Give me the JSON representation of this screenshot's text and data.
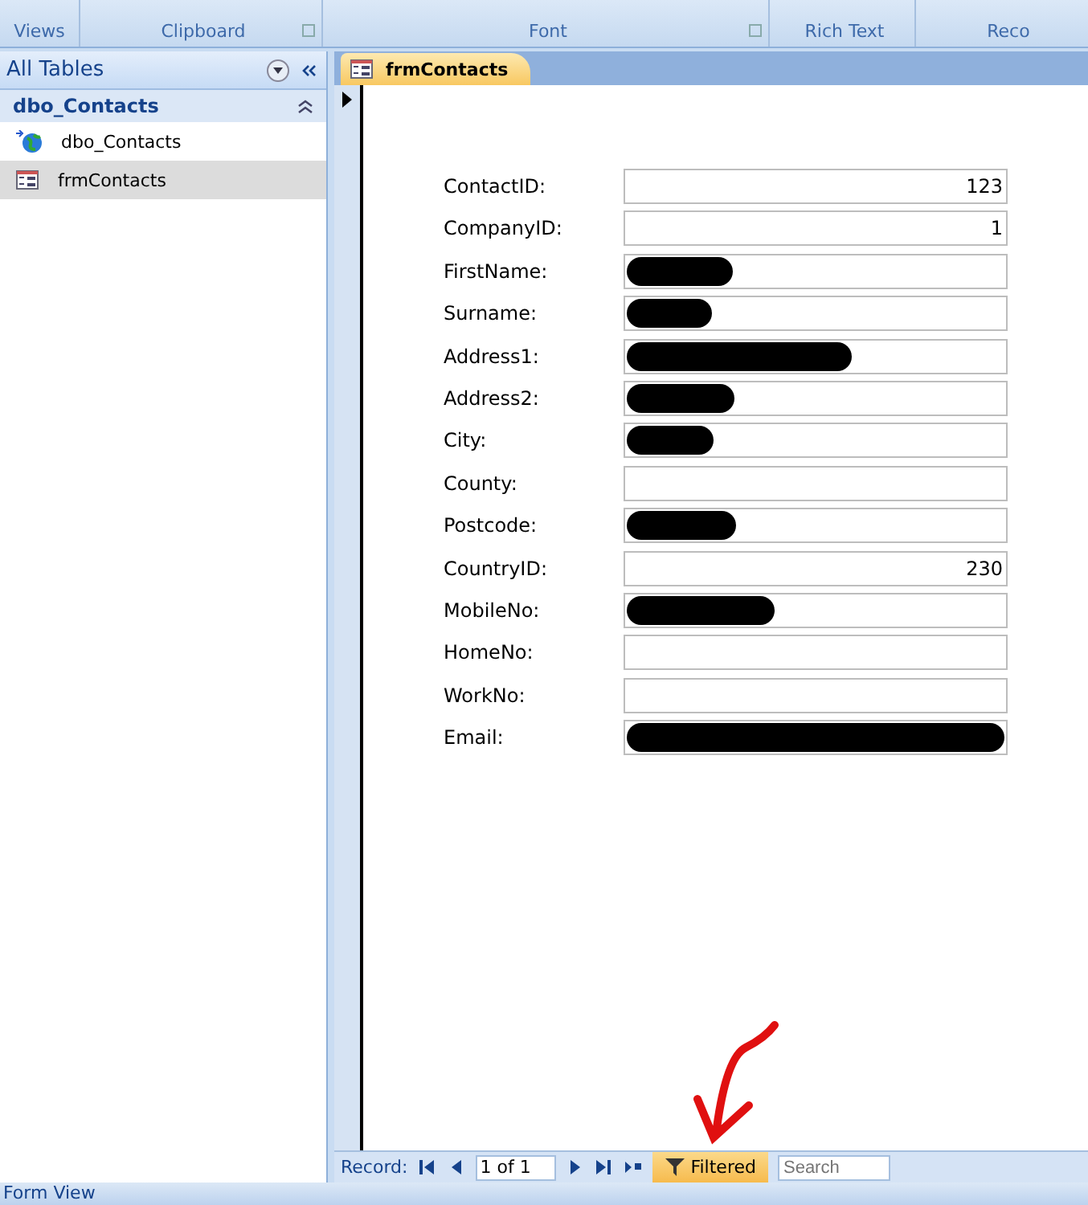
{
  "ribbon": {
    "groups": [
      {
        "label": "Views",
        "launcher": false
      },
      {
        "label": "Clipboard",
        "launcher": true
      },
      {
        "label": "Font",
        "launcher": true
      },
      {
        "label": "Rich Text",
        "launcher": false
      },
      {
        "label": "Reco",
        "launcher": false
      }
    ]
  },
  "nav_pane": {
    "title": "All Tables",
    "group": "dbo_Contacts",
    "items": [
      {
        "kind": "table",
        "label": "dbo_Contacts",
        "selected": false
      },
      {
        "kind": "form",
        "label": "frmContacts",
        "selected": true
      }
    ]
  },
  "document_tab": {
    "label": "frmContacts"
  },
  "form": {
    "fields": [
      {
        "label": "ContactID:",
        "value": "123",
        "redacted": false
      },
      {
        "label": "CompanyID:",
        "value": "1",
        "redacted": false
      },
      {
        "label": "FirstName:",
        "redacted": true
      },
      {
        "label": "Surname:",
        "redacted": true
      },
      {
        "label": "Address1:",
        "redacted": true
      },
      {
        "label": "Address2:",
        "redacted": true
      },
      {
        "label": "City:",
        "redacted": true
      },
      {
        "label": "County:",
        "redacted": false
      },
      {
        "label": "Postcode:",
        "redacted": true
      },
      {
        "label": "CountryID:",
        "value": "230",
        "redacted": false
      },
      {
        "label": "MobileNo:",
        "redacted": true
      },
      {
        "label": "HomeNo:",
        "redacted": false
      },
      {
        "label": "WorkNo:",
        "redacted": false
      },
      {
        "label": "Email:",
        "redacted": true
      }
    ]
  },
  "record_nav": {
    "label": "Record:",
    "position": "1 of 1",
    "filter": "Filtered",
    "search_placeholder": "Search"
  },
  "status_bar": {
    "text": "Form View"
  }
}
